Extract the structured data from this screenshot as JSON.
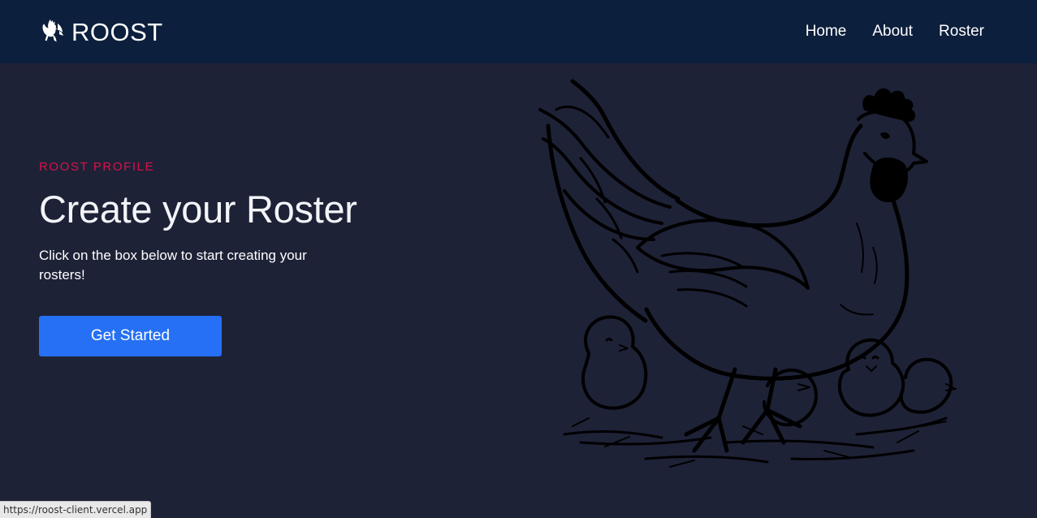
{
  "navbar": {
    "brand": {
      "name": "ROOST",
      "logo_icon": "rooster-icon"
    },
    "links": [
      {
        "label": "Home"
      },
      {
        "label": "About"
      },
      {
        "label": "Roster"
      }
    ],
    "background": "#0c1f3c"
  },
  "hero": {
    "eyebrow": "ROOST PROFILE",
    "title": "Create your Roster",
    "description": "Click on the box below to start creating your rosters!",
    "cta_label": "Get Started",
    "illustration_icon": "hen-with-chicks-illustration"
  },
  "status_bar": {
    "url": "https://roost-client.vercel.app"
  },
  "colors": {
    "page_background": "#1e2237",
    "accent": "#d7124a",
    "button": "#2570f5",
    "text": "#ffffff"
  }
}
